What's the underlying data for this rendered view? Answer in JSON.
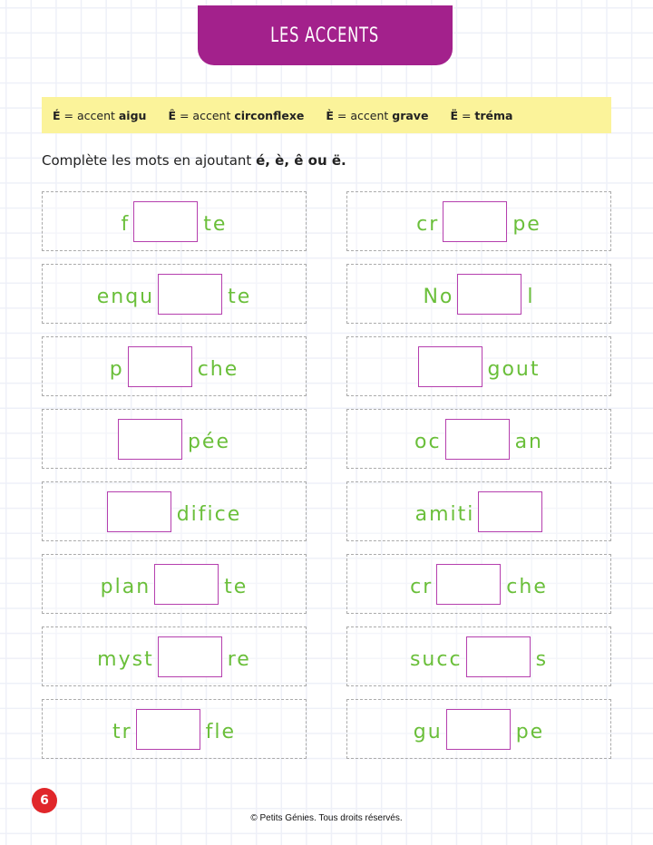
{
  "header": {
    "title": "LES ACCENTS"
  },
  "legend": [
    {
      "letter": "É",
      "text": " = accent ",
      "name": "aigu"
    },
    {
      "letter": "Ê",
      "text": " = accent ",
      "name": "circonflexe"
    },
    {
      "letter": "È",
      "text": " = accent ",
      "name": "grave"
    },
    {
      "letter": "Ë",
      "text": " = ",
      "name": "tréma"
    }
  ],
  "instruction": {
    "text": "Complète les mots en ajoutant ",
    "letters": "é, è, ê ou ë."
  },
  "words": [
    {
      "before": "f",
      "after": "te"
    },
    {
      "before": "cr",
      "after": "pe"
    },
    {
      "before": "enqu",
      "after": "te"
    },
    {
      "before": "No",
      "after": "l"
    },
    {
      "before": "p",
      "after": "che"
    },
    {
      "before": "",
      "after": "gout"
    },
    {
      "before": "",
      "after": "pée"
    },
    {
      "before": "oc",
      "after": "an"
    },
    {
      "before": "",
      "after": "difice"
    },
    {
      "before": "amiti",
      "after": ""
    },
    {
      "before": "plan",
      "after": "te"
    },
    {
      "before": "cr",
      "after": "che"
    },
    {
      "before": "myst",
      "after": "re"
    },
    {
      "before": "succ",
      "after": "s"
    },
    {
      "before": "tr",
      "after": "fle"
    },
    {
      "before": "gu",
      "after": "pe"
    }
  ],
  "footer": {
    "page_number": "6",
    "copyright": "© Petits Génies. Tous droits réservés."
  },
  "colors": {
    "banner": "#a3218c",
    "legend_bg": "#fbf39a",
    "word_text": "#6abf3a",
    "blank_border": "#b53fae",
    "page_badge": "#e0262a"
  }
}
